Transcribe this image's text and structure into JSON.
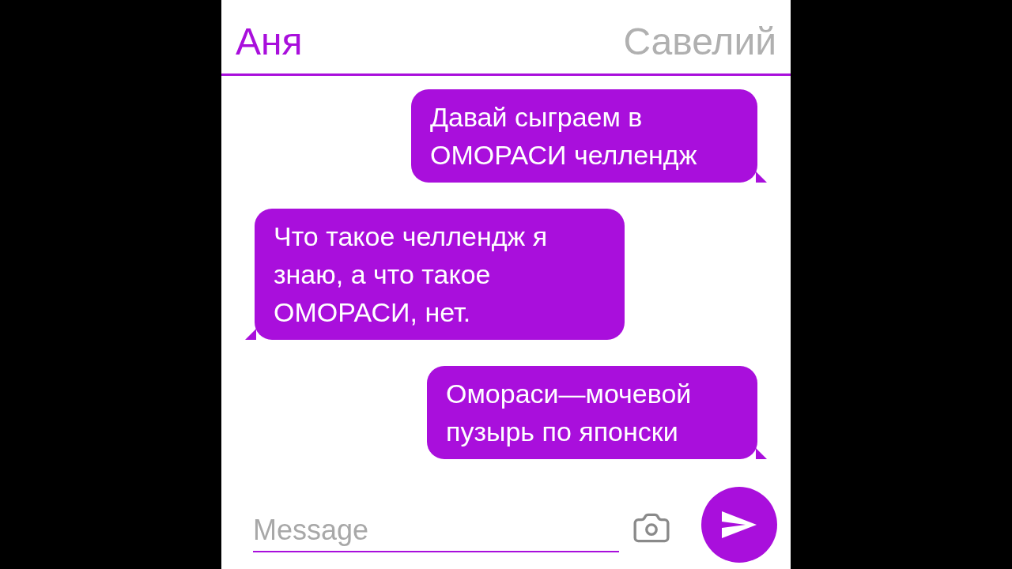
{
  "header": {
    "contacts": [
      {
        "name": "Аня",
        "selected": true
      },
      {
        "name": "Савелий",
        "selected": false
      }
    ]
  },
  "messages": [
    {
      "kind": "out",
      "text": "Давай сыграем в ОМОРАСИ челлендж"
    },
    {
      "kind": "in",
      "text": "Что такое челлендж я знаю, а что такое ОМОРАСИ, нет."
    },
    {
      "kind": "out",
      "text": "Омораси—мочевой пузырь по японски"
    }
  ],
  "composer": {
    "placeholder": "Message"
  }
}
